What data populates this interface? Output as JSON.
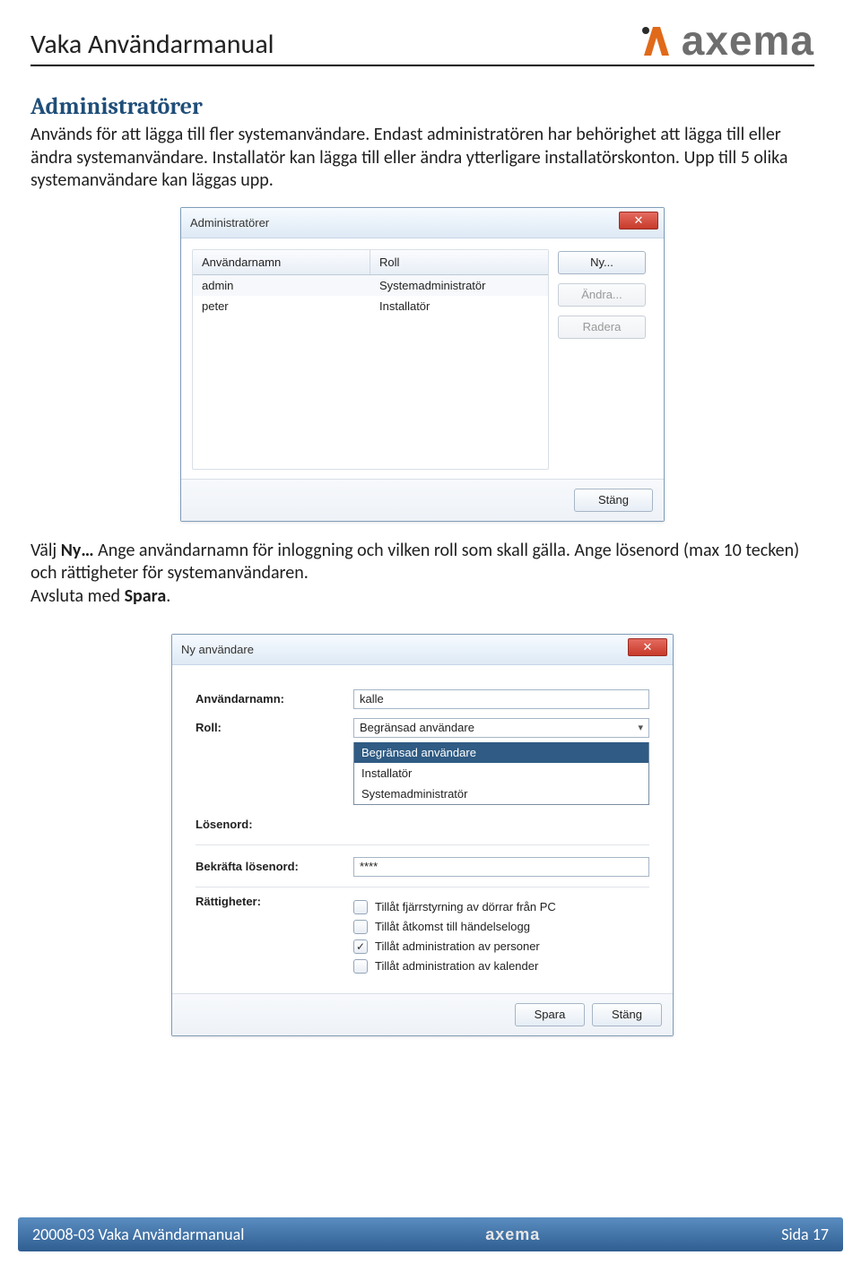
{
  "header": {
    "title": "Vaka Användarmanual",
    "brand": "axema"
  },
  "section": {
    "heading": "Administratörer",
    "p1": "Används för att lägga till fler systemanvändare. Endast administratören har behörighet att lägga till eller ändra systemanvändare. Installatör kan lägga till eller ändra ytterligare installatörskonton. Upp till 5 olika systemanvändare kan läggas upp.",
    "p2a": "Välj ",
    "p2b": "Ny…",
    "p2c": " Ange användarnamn för inloggning och vilken roll som skall gälla. Ange lösenord (max 10 tecken) och rättigheter för systemanvändaren.",
    "p3": " Avsluta med ",
    "p3b": "Spara",
    "p3c": "."
  },
  "dlg_admins": {
    "title": "Administratörer",
    "close": "✕",
    "columns": {
      "user": "Användarnamn",
      "role": "Roll"
    },
    "rows": [
      {
        "user": "admin",
        "role": "Systemadministratör"
      },
      {
        "user": "peter",
        "role": "Installatör"
      }
    ],
    "buttons": {
      "new": "Ny...",
      "edit": "Ändra...",
      "delete": "Radera",
      "close": "Stäng"
    }
  },
  "dlg_newuser": {
    "title": "Ny användare",
    "close": "✕",
    "labels": {
      "username": "Användarnamn:",
      "role": "Roll:",
      "password": "Lösenord:",
      "confirm": "Bekräfta lösenord:",
      "rights": "Rättigheter:"
    },
    "username_value": "kalle",
    "role_selected": "Begränsad användare",
    "role_options": [
      "Begränsad användare",
      "Installatör",
      "Systemadministratör"
    ],
    "confirm_value": "****",
    "rights": [
      {
        "label": "Tillåt fjärrstyrning av dörrar från PC",
        "checked": false
      },
      {
        "label": "Tillåt åtkomst till händelselogg",
        "checked": false
      },
      {
        "label": "Tillåt administration av personer",
        "checked": true
      },
      {
        "label": "Tillåt administration av kalender",
        "checked": false
      }
    ],
    "buttons": {
      "save": "Spara",
      "close": "Stäng"
    }
  },
  "footer": {
    "left": "20008-03 Vaka Användarmanual",
    "brand": "axema",
    "right": "Sida 17"
  }
}
